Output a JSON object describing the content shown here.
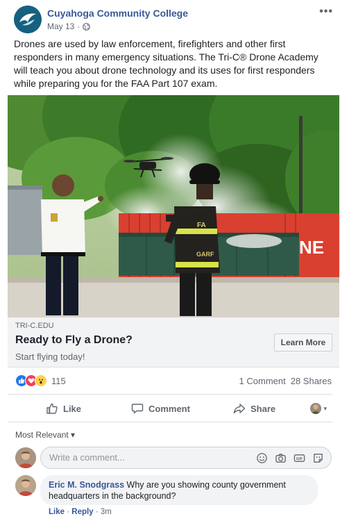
{
  "post": {
    "page_name": "Cuyahoga Community College",
    "date": "May 13",
    "dot": "·",
    "more": "•••",
    "text": "Drones are used by law enforcement, firefighters and other first responders in many emergency situations. The Tri-C® Drone Academy will teach you about drone technology and its uses for first responders while preparing you for the FAA Part 107 exam."
  },
  "photo": {
    "helmet_text": "FA",
    "coat_text": "GARF",
    "container_text": "NE"
  },
  "link": {
    "domain": "TRI-C.EDU",
    "title": "Ready to Fly a Drone?",
    "subtitle": "Start flying today!",
    "button": "Learn More"
  },
  "reactions": {
    "count": "115",
    "comments": "1 Comment",
    "shares": "28 Shares"
  },
  "actions": {
    "like": "Like",
    "comment": "Comment",
    "share": "Share"
  },
  "comments": {
    "sort": "Most Relevant",
    "sort_caret": "▾",
    "placeholder": "Write a comment...",
    "items": [
      {
        "author": "Eric M. Snodgrass",
        "text": "Why are you showing county government headquarters in the background?",
        "like": "Like",
        "reply": "Reply",
        "time": "3m",
        "sep": "·"
      }
    ]
  },
  "colors": {
    "link_blue": "#385898",
    "like_blue": "#2078f4",
    "love_red": "#f33e58",
    "wow_yellow": "#fcd14b",
    "tree_green": "#3d7a2a",
    "container_red": "#d9402f",
    "dumpster_green": "#2f5a4a"
  }
}
